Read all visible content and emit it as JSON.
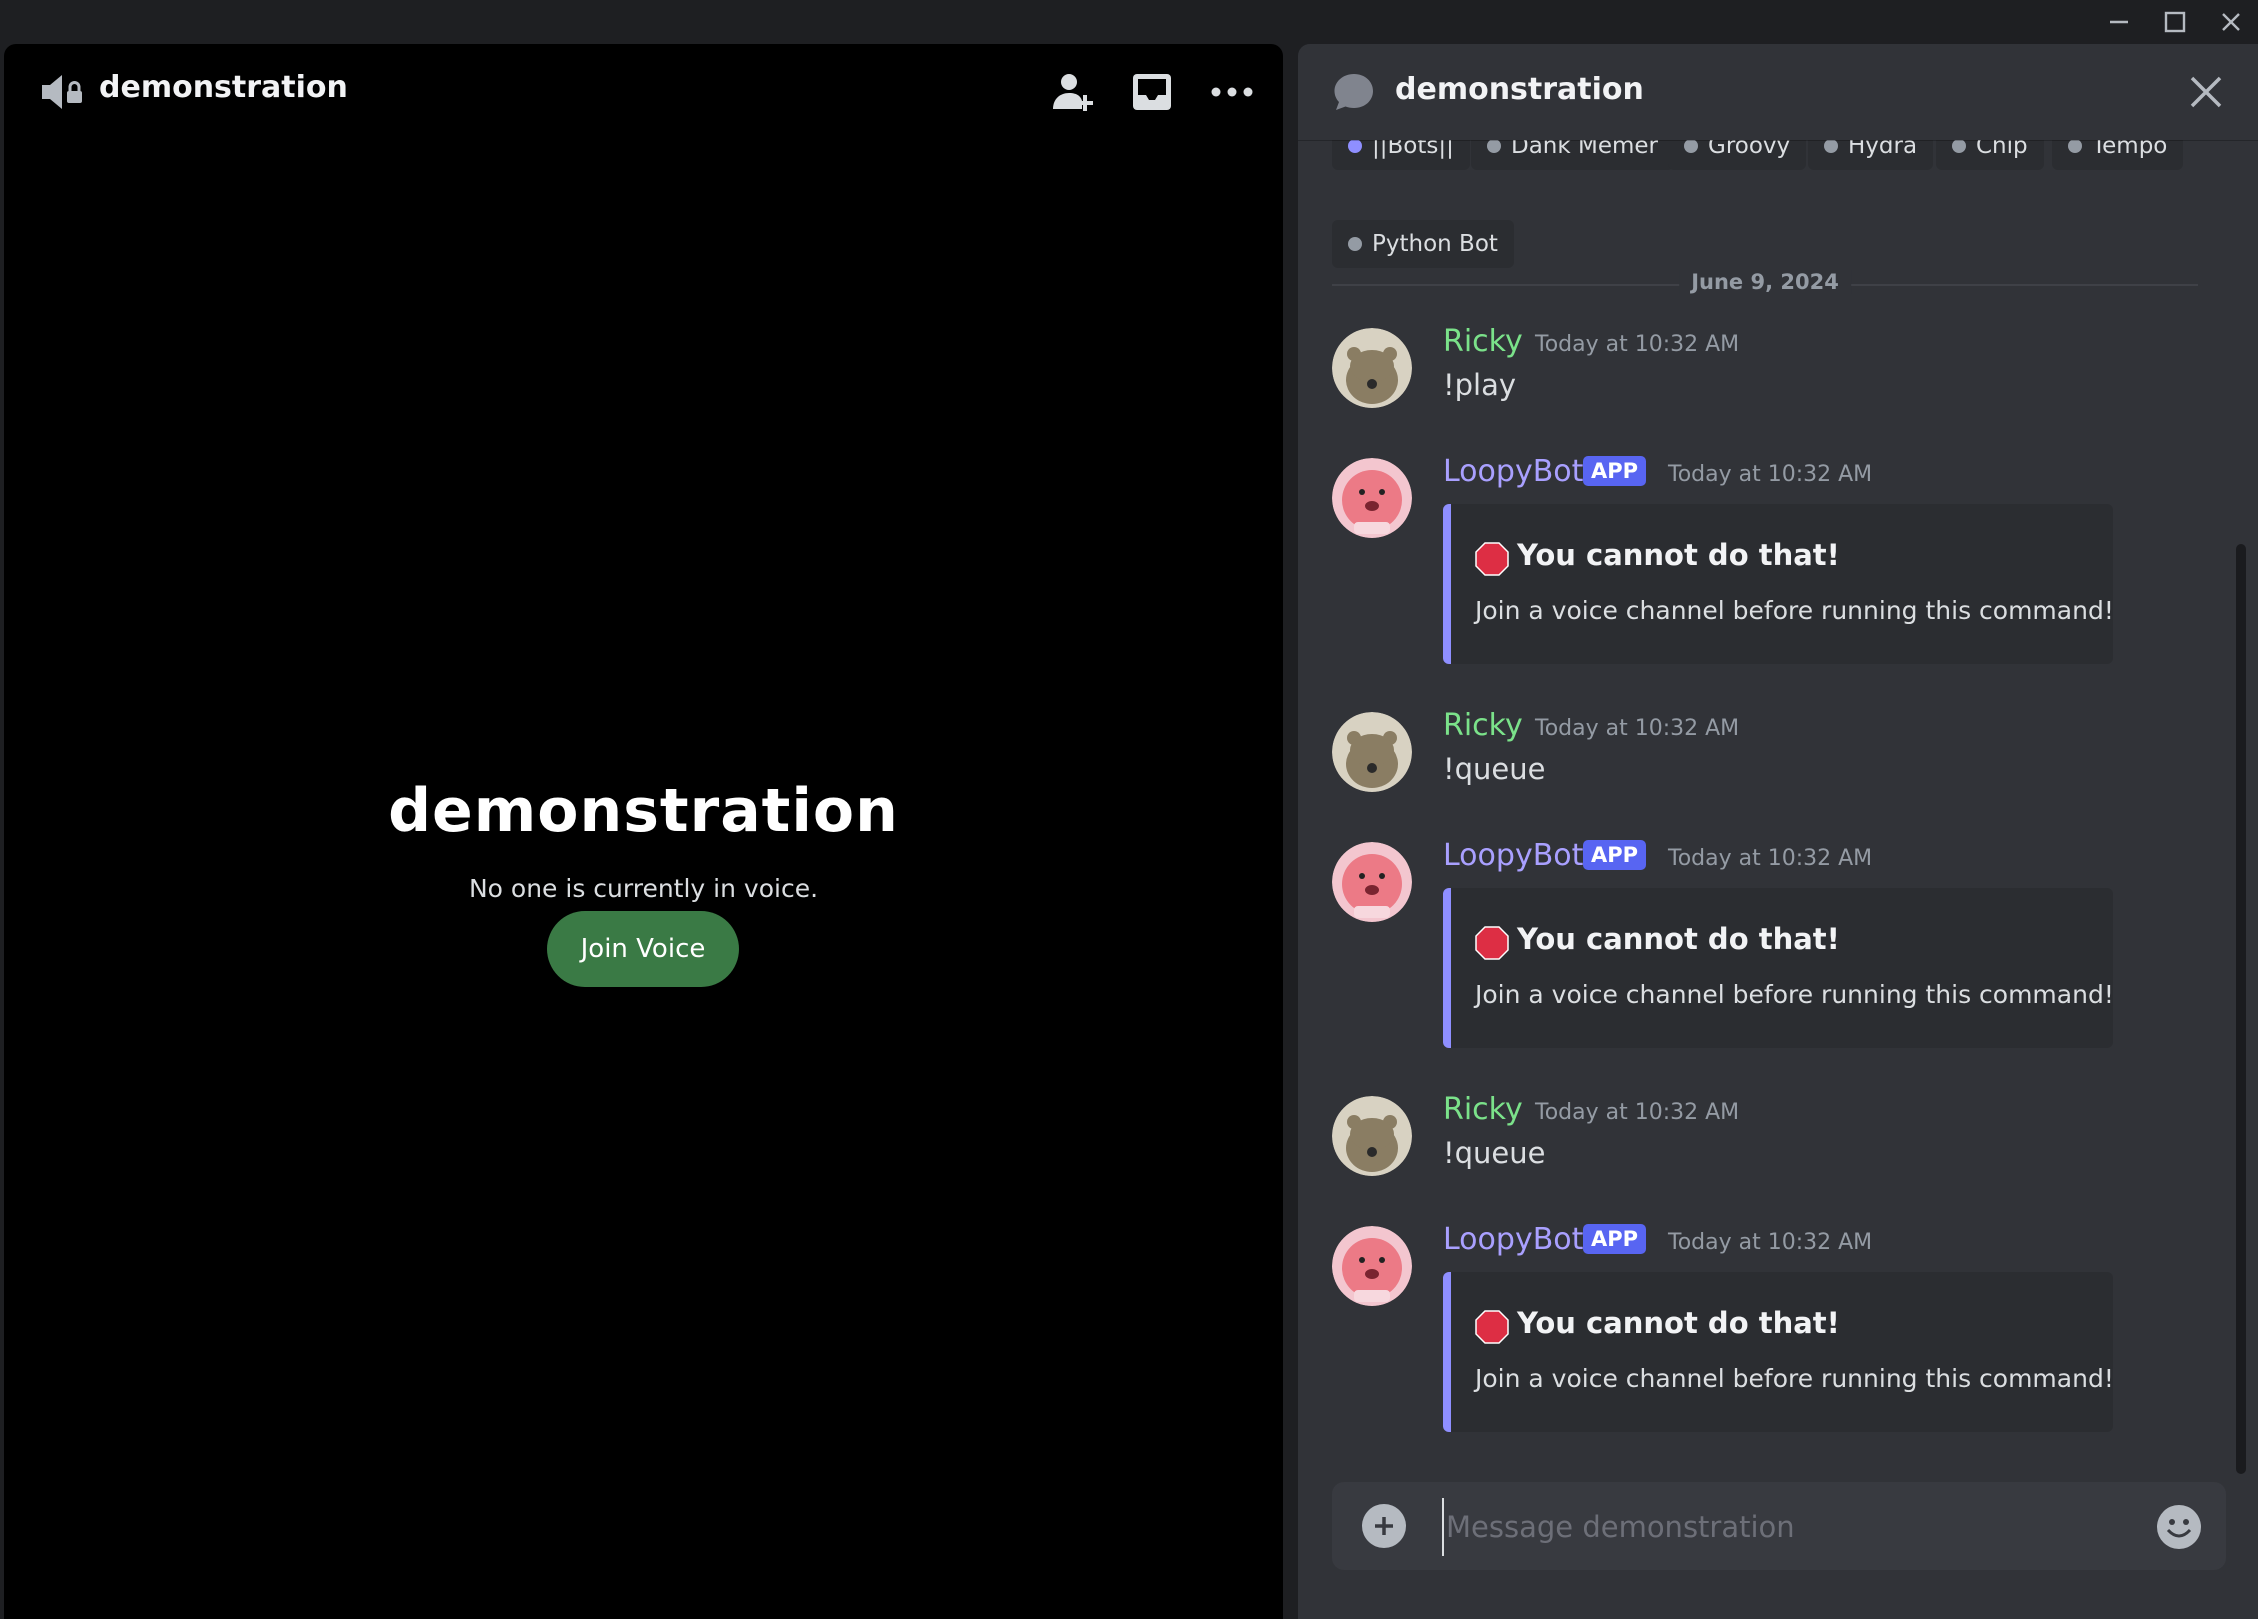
{
  "window": {
    "controls": [
      "minimize",
      "maximize",
      "close"
    ]
  },
  "voice_panel": {
    "channel_name": "demonstration",
    "heading": "demonstration",
    "status": "No one is currently in voice.",
    "join_label": "Join Voice"
  },
  "chat_panel": {
    "channel_name": "demonstration",
    "tags": [
      {
        "label": "||Bots||",
        "color": "#8f8fff"
      },
      {
        "label": "Dank Memer",
        "color": "#949ba4"
      },
      {
        "label": "Groovy",
        "color": "#949ba4"
      },
      {
        "label": "Hydra",
        "color": "#949ba4"
      },
      {
        "label": "Chip",
        "color": "#949ba4"
      },
      {
        "label": "Tempo",
        "color": "#949ba4"
      },
      {
        "label": "Python Bot",
        "color": "#949ba4"
      }
    ],
    "date_divider": "June 9, 2024",
    "messages": [
      {
        "author": "Ricky",
        "type": "user",
        "time": "Today at 10:32 AM",
        "content": "!play"
      },
      {
        "author": "LoopyBot",
        "type": "bot",
        "badge": "APP",
        "time": "Today at 10:32 AM",
        "embed_title": "You cannot do that!",
        "embed_desc": "Join a voice channel before running this command!"
      },
      {
        "author": "Ricky",
        "type": "user",
        "time": "Today at 10:32 AM",
        "content": "!queue"
      },
      {
        "author": "LoopyBot",
        "type": "bot",
        "badge": "APP",
        "time": "Today at 10:32 AM",
        "embed_title": "You cannot do that!",
        "embed_desc": "Join a voice channel before running this command!"
      },
      {
        "author": "Ricky",
        "type": "user",
        "time": "Today at 10:32 AM",
        "content": "!queue"
      },
      {
        "author": "LoopyBot",
        "type": "bot",
        "badge": "APP",
        "time": "Today at 10:32 AM",
        "embed_title": "You cannot do that!",
        "embed_desc": "Join a voice channel before running this command!"
      }
    ],
    "input": {
      "value": "",
      "placeholder": "Message demonstration"
    }
  },
  "colors": {
    "join_button": "#3a7a45",
    "user_name": "#7be28a",
    "bot_name": "#a9a0ff",
    "app_badge": "#5865f2",
    "embed_border": "#8f8fff"
  }
}
